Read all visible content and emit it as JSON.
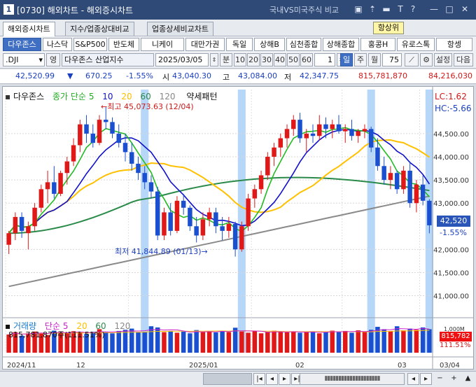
{
  "window": {
    "number": "1",
    "title": "[0730] 해외차트 - 해외증시차트",
    "compare_label": "국내VS미국주식 비교",
    "icons": [
      "chart-icon",
      "pin-icon",
      "minus-icon",
      "text-icon",
      "help-icon",
      "minimize-icon",
      "maximize-icon",
      "close-icon"
    ]
  },
  "tabs": [
    "해외증시차트",
    "지수/업종상대비교",
    "업종상세비교차트"
  ],
  "hangsang_label": "항상위",
  "indices": [
    "다우존스",
    "나스닥",
    "S&P500",
    "반도체",
    "니케이",
    "대만가권",
    "독일",
    "상해B",
    "심천종합",
    "상해종합",
    "홍콩H",
    "유로스톡",
    "항셍"
  ],
  "controls": {
    "symbol": ".DJI",
    "eng_toggle": "영",
    "name": "다우존스 산업지수",
    "date": "2025/03/05",
    "bun": "분",
    "periods": [
      "10",
      "20",
      "30",
      "40",
      "50",
      "60"
    ],
    "count": "1",
    "units": [
      "일",
      "주",
      "월"
    ],
    "bars": "75",
    "settings": "설정",
    "next": "다음"
  },
  "price": {
    "last": "42,520.99",
    "arrow": "▼",
    "change": "670.25",
    "change_pct": "-1.55%",
    "open_label": "시",
    "open": "43,040.30",
    "high_label": "고",
    "high": "43,084.00",
    "low_label": "저",
    "low": "42,347.75",
    "volume": "815,781,870",
    "amount": "84,216,030"
  },
  "chart": {
    "legend": {
      "name": "다우존스",
      "close": "종가",
      "ma_type": "단순",
      "ma5": "5",
      "ma10": "10",
      "ma20": "20",
      "ma60": "60",
      "ma120": "120",
      "pattern": "약세패턴"
    },
    "lc": "LC:1.62",
    "hc": "HC:-5.66",
    "high_note": "최고 45,073.63 (12/04)",
    "low_note": "최저 41,844.89 (01/13)",
    "current_tag": "42,520",
    "current_pct": "-1.55%",
    "vol_legend": {
      "name": "거래량",
      "ma_type": "단순",
      "ma5": "5",
      "ma20": "20",
      "ma60": "60",
      "ma120": "120",
      "value": "815,781,870주(111.51%)"
    },
    "vol_tag": "815,782",
    "vol_pct": "111.51%",
    "vol_axis_label": "1,000M",
    "x_labels": [
      "2024/11",
      "12",
      "2025/01",
      "02",
      "03",
      "03/04"
    ],
    "y_labels": [
      "44,500.00",
      "44,000.00",
      "43,500.00",
      "43,000.00",
      "42,000.00",
      "41,500.00",
      "41,000.00"
    ]
  },
  "chart_data": {
    "type": "candlestick",
    "y_ticks": [
      44500,
      44000,
      43500,
      43000,
      42000,
      41500,
      41000
    ],
    "ylim": [
      40600,
      45300
    ],
    "candles": [
      [
        42100,
        42400,
        41900,
        42350
      ],
      [
        42350,
        42800,
        42200,
        42700
      ],
      [
        42700,
        42800,
        42250,
        42400
      ],
      [
        42350,
        42600,
        42000,
        42500
      ],
      [
        42500,
        43000,
        42400,
        42900
      ],
      [
        42900,
        43400,
        42800,
        43300
      ],
      [
        43300,
        43700,
        43000,
        43450
      ],
      [
        43450,
        43800,
        43100,
        43200
      ],
      [
        43200,
        43700,
        43150,
        43650
      ],
      [
        43650,
        44000,
        43400,
        43900
      ],
      [
        43900,
        44400,
        43800,
        44250
      ],
      [
        44250,
        44800,
        44100,
        44700
      ],
      [
        44700,
        44900,
        44300,
        44500
      ],
      [
        44500,
        44700,
        44200,
        44300
      ],
      [
        44300,
        44900,
        44250,
        44800
      ],
      [
        44800,
        45073,
        44600,
        44750
      ],
      [
        44750,
        44850,
        44400,
        44500
      ],
      [
        44500,
        44700,
        44200,
        44300
      ],
      [
        44300,
        44500,
        43900,
        44100
      ],
      [
        44100,
        44300,
        43700,
        43850
      ],
      [
        43850,
        44000,
        43500,
        43650
      ],
      [
        43650,
        43800,
        43300,
        43450
      ],
      [
        43450,
        43600,
        43100,
        43250
      ],
      [
        43250,
        43350,
        42200,
        42300
      ],
      [
        42300,
        42900,
        42200,
        42800
      ],
      [
        42800,
        43000,
        42300,
        42400
      ],
      [
        42400,
        43150,
        42350,
        43050
      ],
      [
        43050,
        43200,
        42750,
        42900
      ],
      [
        42900,
        42950,
        42400,
        42500
      ],
      [
        42500,
        42700,
        42150,
        42300
      ],
      [
        42300,
        42800,
        42200,
        42650
      ],
      [
        42650,
        42900,
        42500,
        42800
      ],
      [
        42800,
        42900,
        42350,
        42500
      ],
      [
        42500,
        42700,
        42200,
        42400
      ],
      [
        42400,
        42700,
        42250,
        42550
      ],
      [
        42550,
        42600,
        41844,
        42000
      ],
      [
        42000,
        42600,
        41950,
        42500
      ],
      [
        42500,
        43200,
        42400,
        43100
      ],
      [
        43100,
        43400,
        42900,
        43300
      ],
      [
        43300,
        43700,
        43200,
        43600
      ],
      [
        43600,
        44100,
        43500,
        44000
      ],
      [
        44000,
        44300,
        43800,
        44200
      ],
      [
        44200,
        44500,
        44000,
        44400
      ],
      [
        44400,
        44700,
        44200,
        44600
      ],
      [
        44600,
        44900,
        44450,
        44800
      ],
      [
        44800,
        44950,
        44300,
        44400
      ],
      [
        44400,
        44600,
        44100,
        44500
      ],
      [
        44500,
        44700,
        44300,
        44450
      ],
      [
        44450,
        44900,
        44350,
        44700
      ],
      [
        44700,
        44850,
        44400,
        44600
      ],
      [
        44600,
        44800,
        44400,
        44700
      ],
      [
        44700,
        44900,
        44500,
        44550
      ],
      [
        44550,
        44700,
        44300,
        44600
      ],
      [
        44600,
        44800,
        44350,
        44450
      ],
      [
        44450,
        44600,
        44300,
        44550
      ],
      [
        44550,
        44700,
        44400,
        44600
      ],
      [
        44600,
        44650,
        44100,
        44200
      ],
      [
        44200,
        44400,
        43700,
        43800
      ],
      [
        43800,
        44000,
        43400,
        43500
      ],
      [
        43500,
        43800,
        43300,
        43650
      ],
      [
        43650,
        43700,
        43200,
        43300
      ],
      [
        43300,
        43800,
        43200,
        43700
      ],
      [
        43700,
        43900,
        42900,
        43000
      ],
      [
        43000,
        43500,
        42800,
        43400
      ],
      [
        43400,
        43600,
        42950,
        43050
      ],
      [
        43050,
        43084,
        42347,
        42520
      ]
    ],
    "highlight_bars": [
      21,
      36,
      56,
      65
    ],
    "volume": [
      0.62,
      0.7,
      0.58,
      0.66,
      0.72,
      0.68,
      0.6,
      0.75,
      0.7,
      0.66,
      0.73,
      0.69,
      0.64,
      0.71,
      0.8,
      0.7,
      0.66,
      0.74,
      0.78,
      0.82,
      0.69,
      0.71,
      0.9,
      0.86,
      0.7,
      0.74,
      0.68,
      0.72,
      0.66,
      0.77,
      0.7,
      0.73,
      0.69,
      0.75,
      0.7,
      0.85,
      0.72,
      0.68,
      0.74,
      0.66,
      0.7,
      0.75,
      0.71,
      0.69,
      0.72,
      0.68,
      0.7,
      0.73,
      0.66,
      0.72,
      0.75,
      0.7,
      0.74,
      0.68,
      0.76,
      0.71,
      0.78,
      0.88,
      0.8,
      0.73,
      0.9,
      0.76,
      0.82,
      0.78,
      0.86,
      0.8
    ],
    "series": {
      "ma5_color": "#22bb22",
      "ma10_color": "#1111cc",
      "ma20_color": "#ffc000",
      "ma60_color": "#2a8a4a",
      "ma120_color": "#8a8a8a"
    }
  }
}
